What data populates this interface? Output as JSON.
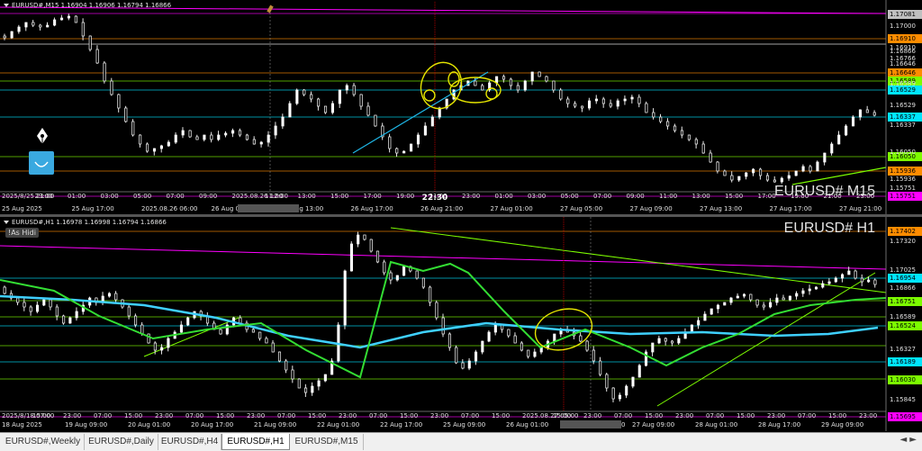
{
  "top": {
    "header": "EURUSD#,M15  1.16904 1.16906 1.16794 1.16866",
    "title": "EURUSD# M15",
    "crosshair_label": "22:30",
    "price_ticks": [
      "1.17000",
      "1.16910",
      "1.16766",
      "1.16646",
      "1.16589",
      "1.16529",
      "1.16337",
      "1.16050",
      "1.15936",
      "1.15751"
    ],
    "price_tags": [
      {
        "text": "1.17081",
        "bg": "#c0c0c0",
        "fg": "#000"
      },
      {
        "text": "1.16910",
        "bg": "#ff8c00",
        "fg": "#000"
      },
      {
        "text": "1.16646",
        "bg": "#ff8c00",
        "fg": "#000"
      },
      {
        "text": "1.16589",
        "bg": "#7cfc00",
        "fg": "#000"
      },
      {
        "text": "1.16529",
        "bg": "#00e5ff",
        "fg": "#000"
      },
      {
        "text": "1.16337",
        "bg": "#00e5ff",
        "fg": "#000"
      },
      {
        "text": "1.16050",
        "bg": "#7cfc00",
        "fg": "#000"
      },
      {
        "text": "1.15936",
        "bg": "#ff8c00",
        "fg": "#000"
      },
      {
        "text": "1.15751",
        "bg": "#ff00ff",
        "fg": "#000"
      }
    ],
    "extra_ticks": [
      "1.16866"
    ],
    "time_labels": [
      "2025/8/25 21:00",
      "23:00",
      "01:00",
      "03:00",
      "05:00",
      "07:00",
      "09:00",
      "2025.08.26 12:00",
      "11:00",
      "13:00",
      "15:00",
      "17:00",
      "19:00",
      "21:00",
      "23:00",
      "01:00",
      "03:00",
      "05:00",
      "07:00",
      "09:00",
      "11:00",
      "13:00",
      "15:00",
      "17:00",
      "19:00",
      "21:00",
      "23:00"
    ],
    "date_labels": [
      "25 Aug 2025",
      "25 Aug 17:00",
      "2025.08.26 06:00",
      "26 Aug 09:00",
      "26 Aug 13:00",
      "26 Aug 17:00",
      "26 Aug 21:00",
      "27 Aug 01:00",
      "27 Aug 05:00",
      "27 Aug 09:00",
      "27 Aug 13:00",
      "27 Aug 17:00",
      "27 Aug 21:00"
    ]
  },
  "bottom": {
    "header": "EURUSD#,H1  1.16978 1.16998 1.16794 1.16866",
    "title": "EURUSD# H1",
    "badge": "!As Hidi",
    "price_ticks": [
      "1.17320",
      "1.17025",
      "1.16866",
      "1.16589",
      "1.16327",
      "1.15845"
    ],
    "price_tags": [
      {
        "text": "1.17402",
        "bg": "#ff8c00",
        "fg": "#000"
      },
      {
        "text": "1.16954",
        "bg": "#00e5ff",
        "fg": "#000"
      },
      {
        "text": "1.16751",
        "bg": "#7cfc00",
        "fg": "#000"
      },
      {
        "text": "1.16524",
        "bg": "#7cfc00",
        "fg": "#000"
      },
      {
        "text": "1.16189",
        "bg": "#00e5ff",
        "fg": "#000"
      },
      {
        "text": "1.16030",
        "bg": "#7cfc00",
        "fg": "#000"
      },
      {
        "text": "1.15695",
        "bg": "#ff00ff",
        "fg": "#000"
      }
    ],
    "time_labels": [
      "2025/8/18 07:00",
      "15:00",
      "23:00",
      "07:00",
      "15:00",
      "23:00",
      "07:00",
      "15:00",
      "23:00",
      "07:00",
      "15:00",
      "23:00",
      "07:00",
      "15:00",
      "23:00",
      "07:00",
      "15:00",
      "2025.08.27 05:00",
      "15:00",
      "23:00",
      "07:00",
      "15:00",
      "23:00",
      "07:00",
      "15:00",
      "23:00",
      "07:00",
      "15:00",
      "23:00"
    ],
    "date_labels": [
      "18 Aug 2025",
      "19 Aug 09:00",
      "20 Aug 01:00",
      "20 Aug 17:00",
      "21 Aug 09:00",
      "22 Aug 01:00",
      "22 Aug 17:00",
      "25 Aug 09:00",
      "26 Aug 01:00",
      "2025.08.26 23:00",
      "27 Aug 09:00",
      "28 Aug 01:00",
      "28 Aug 17:00",
      "29 Aug 09:00"
    ]
  },
  "tabs": [
    "EURUSD#,Weekly",
    "EURUSD#,Daily",
    "EURUSD#,H4",
    "EURUSD#,H1",
    "EURUSD#,M15"
  ],
  "active_tab": "EURUSD#,H1",
  "nav": "◄ ►"
}
